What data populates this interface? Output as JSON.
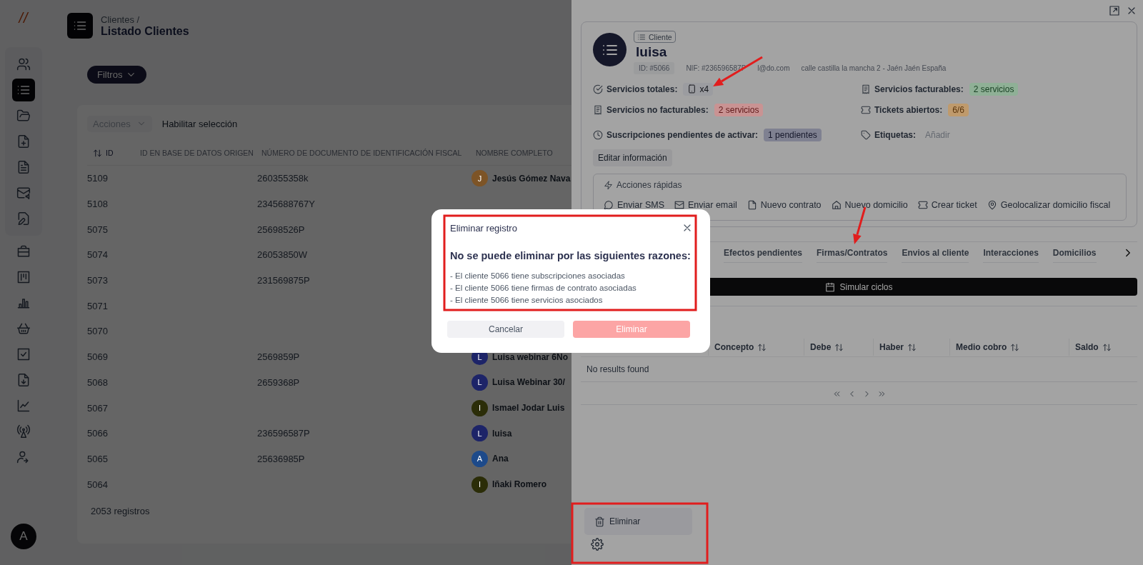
{
  "logo": "//",
  "sidebar": {
    "primary_items": [
      {
        "kind": "users",
        "selected": false
      },
      {
        "kind": "list",
        "selected": true
      },
      {
        "kind": "folder",
        "selected": false
      },
      {
        "kind": "file-plus",
        "selected": false
      },
      {
        "kind": "file-text",
        "selected": false
      },
      {
        "kind": "mail",
        "selected": false
      },
      {
        "kind": "file-edit",
        "selected": false
      }
    ],
    "secondary_items": [
      {
        "kind": "briefcase",
        "selected": false
      },
      {
        "kind": "board",
        "selected": false
      },
      {
        "kind": "chart",
        "selected": false
      },
      {
        "kind": "basket",
        "selected": false
      },
      {
        "kind": "check-square",
        "selected": false
      },
      {
        "kind": "file-down",
        "selected": false
      },
      {
        "kind": "trend",
        "selected": false
      },
      {
        "kind": "antenna",
        "selected": false
      },
      {
        "kind": "user-arrow",
        "selected": false
      }
    ],
    "user_avatar": "A"
  },
  "header": {
    "breadcrumb": "Clientes /",
    "title": "Listado Clientes"
  },
  "filters_button": "Filtros",
  "toolbar": {
    "actions_select": {
      "placeholder": "Acciones"
    },
    "enable_selection": "Habilitar selección"
  },
  "table": {
    "columns": [
      "ID",
      "ID EN BASE DE DATOS ORIGEN",
      "NÚMERO DE DOCUMENTO DE IDENTIFICACIÓN FISCAL",
      "NOMBRE COMPLETO"
    ],
    "rows": [
      {
        "id": "5109",
        "tax_id": "260355358k",
        "name": "Jesús Gómez Nava",
        "avatar": "J",
        "color": "#7d5426"
      },
      {
        "id": "5108",
        "tax_id": "2345688767Y"
      },
      {
        "id": "5075",
        "tax_id": "25698526P"
      },
      {
        "id": "5074",
        "tax_id": "26053850W"
      },
      {
        "id": "5073",
        "tax_id": "231569875P"
      },
      {
        "id": "5071"
      },
      {
        "id": "5070"
      },
      {
        "id": "5069",
        "tax_id": "2569859P",
        "name": "Luisa webinar 6No",
        "avatar": "L",
        "color": "#1d2468"
      },
      {
        "id": "5068",
        "tax_id": "2659368P",
        "name": "Luisa Webinar 30/",
        "avatar": "L",
        "color": "#1d2468"
      },
      {
        "id": "5067",
        "name": "Ismael Jodar Luis",
        "avatar": "I",
        "color": "#2b2d08"
      },
      {
        "id": "5066",
        "tax_id": "236596587P",
        "name": "luisa",
        "avatar": "L",
        "color": "#1d2468"
      },
      {
        "id": "5065",
        "tax_id": "25636985P",
        "name": "Ana",
        "avatar": "A",
        "color": "#1d4a8a"
      },
      {
        "id": "5064",
        "name": "Iñaki Romero",
        "avatar": "I",
        "color": "#2b2d08"
      }
    ],
    "record_count": "2053 registros"
  },
  "drawer": {
    "client": {
      "tag": "Cliente",
      "name": "luisa",
      "id_chip": "ID: #5066",
      "nif": "NIF: #236596587P",
      "email": "l@do.com",
      "address": "calle castilla la mancha 2 - Jaén Jaén España"
    },
    "stats": [
      {
        "kind": "total",
        "label": "Servicios totales:",
        "value": "x4",
        "color": "#9b9ca0"
      },
      {
        "kind": "billable",
        "label": "Servicios facturables:",
        "value": "2 servicios",
        "color": "#8fb096"
      },
      {
        "kind": "unbillable",
        "label": "Servicios no facturables:",
        "value": "2 servicios",
        "color": "#c99393"
      },
      {
        "kind": "tickets",
        "label": "Tickets abiertos:",
        "value": "6/6",
        "color": "#bf9a6c"
      },
      {
        "kind": "pending",
        "label": "Suscripciones pendientes de activar:",
        "value": "1 pendientes",
        "color": "#7f8191"
      },
      {
        "kind": "tags",
        "label": "Etiquetas:",
        "value": "Añadir"
      }
    ],
    "edit_button": "Editar información",
    "quick_actions": {
      "title": "Acciones rápidas",
      "items": [
        {
          "kind": "sms",
          "label": "Enviar SMS"
        },
        {
          "kind": "email",
          "label": "Enviar email"
        },
        {
          "kind": "contract",
          "label": "Nuevo contrato"
        },
        {
          "kind": "address",
          "label": "Nuevo domicilio"
        },
        {
          "kind": "ticket",
          "label": "Crear ticket"
        },
        {
          "kind": "geolocate",
          "label": "Geolocalizar domicilio fiscal"
        }
      ]
    },
    "tabs": [
      {
        "label": "Efectos pendientes",
        "selected": false
      },
      {
        "label": "Firmas/Contratos",
        "selected": false
      },
      {
        "label": "Envios al cliente",
        "selected": false
      },
      {
        "label": "Interacciones",
        "selected": false
      },
      {
        "label": "Domicilios",
        "selected": false
      }
    ],
    "simulate_button": "Simular ciclos",
    "ledger": {
      "columns": [
        "Concepto",
        "Debe",
        "Haber",
        "Medio cobro",
        "Saldo"
      ],
      "empty_text": "No results found"
    },
    "delete_menu_item": "Eliminar"
  },
  "modal": {
    "title": "Eliminar registro",
    "heading": "No se puede eliminar por las siguientes razones:",
    "reasons": [
      "- El cliente 5066 tiene subscripciones asociadas",
      "- El cliente 5066 tiene firmas de contrato asociadas",
      "- El cliente 5066 tiene servicios asociados"
    ],
    "cancel_button": "Cancelar",
    "confirm_button": {
      "label": "Eliminar",
      "disabled": true
    }
  }
}
